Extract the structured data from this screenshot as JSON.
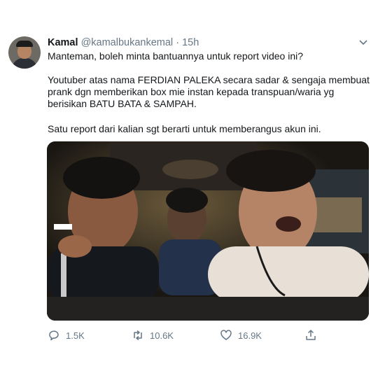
{
  "tweet": {
    "author": {
      "name": "Kamal",
      "handle": "@kamalbukankemal",
      "separator": "·",
      "time": "15h",
      "avatar_icon": "avatar-photo"
    },
    "text": {
      "line1": "Manteman, boleh minta bantuannya untuk report video ini?",
      "paragraph2": "Youtuber atas nama FERDIAN PALEKA secara sadar & sengaja membuat prank dgn memberikan box mie instan kepada transpuan/waria yg berisikan BATU BATA & SAMPAH.",
      "paragraph3": "Satu report dari kalian sgt berarti untuk memberangus akun ini."
    },
    "media": {
      "type": "video-still",
      "description_icon": "video-thumbnail"
    },
    "actions": {
      "reply_count": "1.5K",
      "retweet_count": "10.6K",
      "like_count": "16.9K",
      "icons": [
        "reply-icon",
        "retweet-icon",
        "like-icon",
        "share-icon"
      ]
    }
  },
  "colors": {
    "text_primary": "#14171a",
    "text_secondary": "#657786",
    "background": "#ffffff"
  }
}
